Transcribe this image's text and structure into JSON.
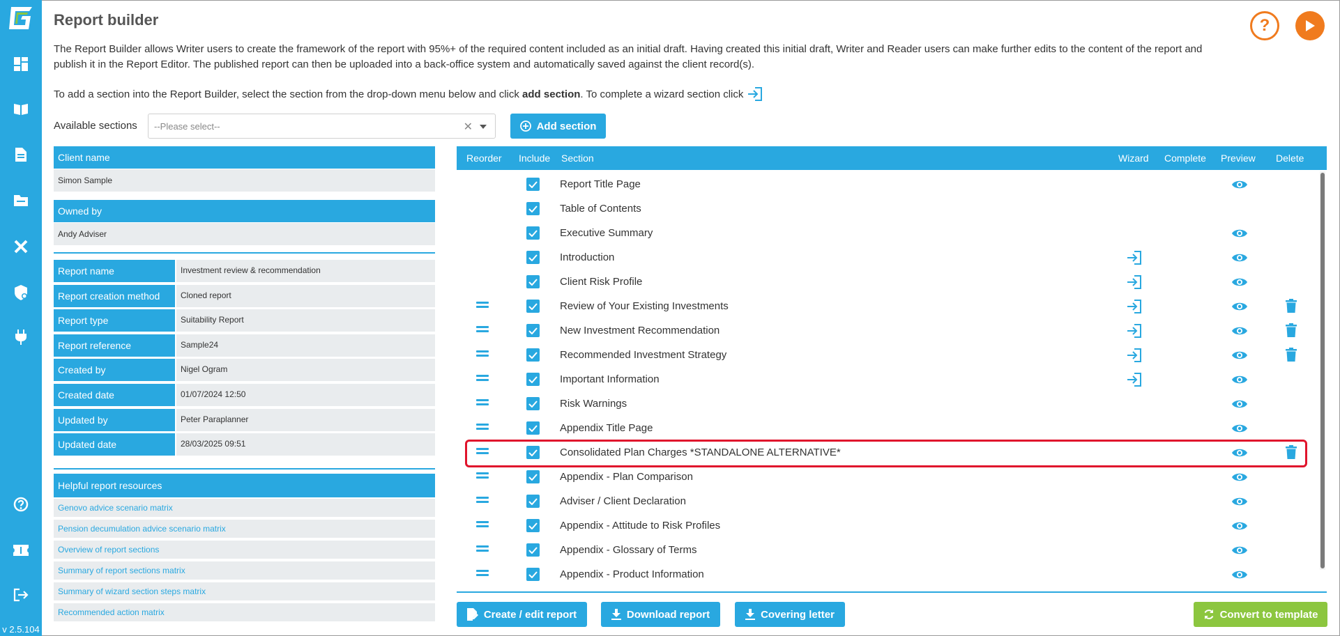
{
  "app": {
    "version": "v 2.5.104"
  },
  "header": {
    "title": "Report builder",
    "intro_text": "The Report Builder allows Writer users to create the framework of the report with 95%+ of the required content included as an initial draft. Having created this initial draft, Writer and Reader users can make further edits to the content of the report and publish it in the Report Editor. The published report can then be uploaded into a back-office system and automatically saved against the client record(s).",
    "instruction_prefix": "To add a section into the Report Builder, select the section from the drop-down menu below and click ",
    "instruction_bold": "add section",
    "instruction_suffix": ". To complete a wizard section click"
  },
  "available_sections": {
    "label": "Available sections",
    "placeholder": "--Please select--",
    "add_button": "Add section"
  },
  "client": {
    "client_name_label": "Client name",
    "client_name": "Simon Sample",
    "owned_by_label": "Owned by",
    "owned_by": "Andy Adviser"
  },
  "report_details": [
    {
      "label": "Report name",
      "value": "Investment review & recommendation"
    },
    {
      "label": "Report creation method",
      "value": "Cloned report"
    },
    {
      "label": "Report type",
      "value": "Suitability Report"
    },
    {
      "label": "Report reference",
      "value": "Sample24"
    },
    {
      "label": "Created by",
      "value": "Nigel Ogram"
    },
    {
      "label": "Created date",
      "value": "01/07/2024 12:50"
    },
    {
      "label": "Updated by",
      "value": "Peter Paraplanner"
    },
    {
      "label": "Updated date",
      "value": "28/03/2025 09:51"
    }
  ],
  "resources": {
    "title": "Helpful report resources",
    "items": [
      "Genovo advice scenario matrix",
      "Pension decumulation advice scenario matrix",
      "Overview of report sections",
      "Summary of report sections matrix",
      "Summary of wizard section steps matrix",
      "Recommended action matrix"
    ]
  },
  "table": {
    "headers": {
      "reorder": "Reorder",
      "include": "Include",
      "section": "Section",
      "wizard": "Wizard",
      "complete": "Complete",
      "preview": "Preview",
      "delete": "Delete"
    },
    "rows": [
      {
        "name": "Report Title Page",
        "reorder": false,
        "wizard": false,
        "preview": true,
        "delete": false
      },
      {
        "name": "Table of Contents",
        "reorder": false,
        "wizard": false,
        "preview": false,
        "delete": false
      },
      {
        "name": "Executive Summary",
        "reorder": false,
        "wizard": false,
        "preview": true,
        "delete": false
      },
      {
        "name": "Introduction",
        "reorder": false,
        "wizard": true,
        "preview": true,
        "delete": false
      },
      {
        "name": "Client Risk Profile",
        "reorder": false,
        "wizard": true,
        "preview": true,
        "delete": false
      },
      {
        "name": "Review of Your Existing Investments",
        "reorder": true,
        "wizard": true,
        "preview": true,
        "delete": true
      },
      {
        "name": "New Investment Recommendation",
        "reorder": true,
        "wizard": true,
        "preview": true,
        "delete": true
      },
      {
        "name": "Recommended Investment Strategy",
        "reorder": true,
        "wizard": true,
        "preview": true,
        "delete": true
      },
      {
        "name": "Important Information",
        "reorder": true,
        "wizard": true,
        "preview": true,
        "delete": false
      },
      {
        "name": "Risk Warnings",
        "reorder": true,
        "wizard": false,
        "preview": true,
        "delete": false
      },
      {
        "name": "Appendix Title Page",
        "reorder": true,
        "wizard": false,
        "preview": true,
        "delete": false
      },
      {
        "name": "Consolidated Plan Charges *STANDALONE ALTERNATIVE*",
        "reorder": true,
        "wizard": false,
        "preview": true,
        "delete": true
      },
      {
        "name": "Appendix - Plan Comparison",
        "reorder": true,
        "wizard": false,
        "preview": true,
        "delete": false
      },
      {
        "name": "Adviser / Client Declaration",
        "reorder": true,
        "wizard": false,
        "preview": true,
        "delete": false
      },
      {
        "name": "Appendix - Attitude to Risk Profiles",
        "reorder": true,
        "wizard": false,
        "preview": true,
        "delete": false
      },
      {
        "name": "Appendix - Glossary of Terms",
        "reorder": true,
        "wizard": false,
        "preview": true,
        "delete": false
      },
      {
        "name": "Appendix - Product Information",
        "reorder": true,
        "wizard": false,
        "preview": true,
        "delete": false
      }
    ]
  },
  "actions": {
    "create_edit": "Create / edit report",
    "download": "Download report",
    "covering_letter": "Covering letter",
    "convert": "Convert to template"
  },
  "colors": {
    "accent": "#29a8e0",
    "orange": "#f07b1e",
    "green": "#8cc63f",
    "highlight": "#e0142c"
  }
}
